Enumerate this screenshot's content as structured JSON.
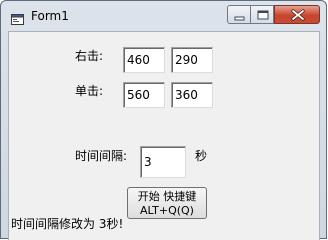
{
  "window": {
    "title": "Form1"
  },
  "form": {
    "right_click_label": "右击:",
    "right_click_x": "460",
    "right_click_y": "290",
    "left_click_label": "单击:",
    "left_click_x": "560",
    "left_click_y": "360",
    "interval_label": "时间间隔:",
    "interval_value": "3",
    "interval_unit": "秒",
    "start_button_line1": "开始 快捷键",
    "start_button_line2": "ALT+Q(Q)",
    "status_text": "时间间隔修改为 3秒!"
  },
  "icons": {
    "app": "form-icon",
    "minimize": "minimize-icon",
    "maximize": "maximize-icon",
    "close": "close-icon"
  },
  "colors": {
    "close_button": "#c8452f",
    "client_background": "#f0f0f0"
  }
}
